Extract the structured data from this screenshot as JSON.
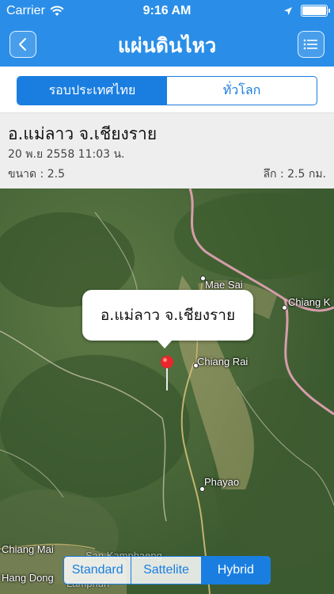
{
  "status_bar": {
    "carrier": "Carrier",
    "time": "9:16 AM",
    "battery_level": 1.0
  },
  "nav": {
    "title": "แผ่นดินไหว",
    "back_icon": "chevron-left-icon",
    "menu_icon": "list-icon"
  },
  "tabs": {
    "items": [
      {
        "label": "รอบประเทศไทย",
        "active": true
      },
      {
        "label": "ทั่วโลก",
        "active": false
      }
    ]
  },
  "quake": {
    "place": "อ.แม่ลาว จ.เชียงราย",
    "date": "20 พ.ย 2558 11:03 น.",
    "magnitude": "ขนาด : 2.5",
    "depth": "ลึก : 2.5 กม."
  },
  "map": {
    "callout": "อ.แม่ลาว จ.เชียงราย",
    "cities": [
      {
        "label": "Mae Sai"
      },
      {
        "label": "Chiang K"
      },
      {
        "label": "Chiang Rai"
      },
      {
        "label": "Phayao"
      },
      {
        "label": "Chiang Mai"
      },
      {
        "label": "San Kamphaeng"
      },
      {
        "label": "Lamphun"
      },
      {
        "label": "Hang Dong"
      }
    ],
    "map_types": [
      {
        "label": "Standard",
        "active": false
      },
      {
        "label": "Sattelite",
        "active": false
      },
      {
        "label": "Hybrid",
        "active": true
      }
    ]
  },
  "colors": {
    "accent": "#2a8ee8",
    "segment_blue": "#1a7ee0",
    "pin": "#e8262b",
    "border_line": "#f0a8c0"
  }
}
